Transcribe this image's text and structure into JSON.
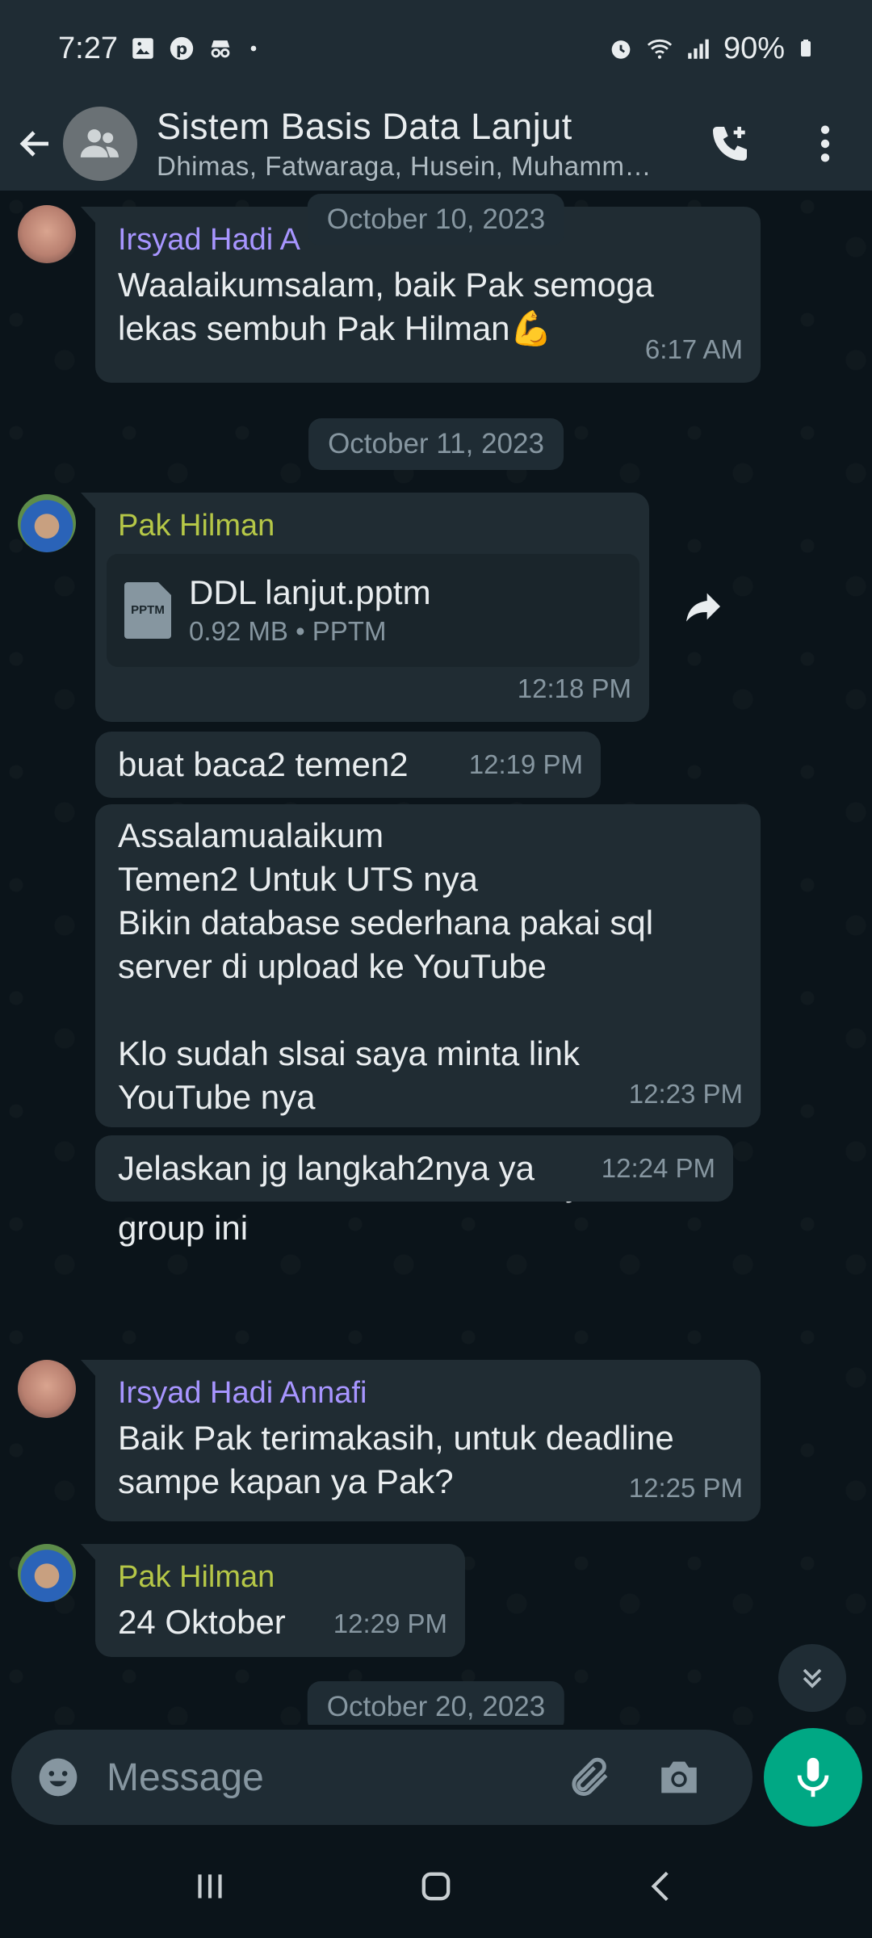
{
  "status_bar": {
    "time": "7:27",
    "battery": "90%",
    "icons": [
      "gallery-icon",
      "pinterest-icon",
      "incognito-icon",
      "dot-icon",
      "alarm-icon",
      "wifi-icon",
      "signal-icon",
      "battery-icon"
    ]
  },
  "header": {
    "title": "Sistem Basis Data Lanjut",
    "subtitle": "Dhimas, Fatwaraga, Husein, Muhamm…"
  },
  "colors": {
    "background": "#0b141a",
    "bar": "#1f2c34",
    "bubble": "#202c33",
    "accent": "#00a884",
    "sender_irsyad": "#a795ff",
    "sender_hilman": "#b5c747",
    "meta_text": "#8696a0"
  },
  "messages": [
    {
      "sender": "Irsyad Hadi A",
      "text": "Waalaikumsalam, baik Pak semoga\nlekas sembuh Pak Hilman💪",
      "time": "6:17 AM"
    },
    {
      "date": "October 10, 2023"
    },
    {
      "date": "October 11, 2023"
    },
    {
      "sender": "Pak Hilman",
      "file_name": "DDL lanjut.pptm",
      "file_info": "0.92 MB • PPTM",
      "file_type": "PPTM",
      "time": "12:18 PM"
    },
    {
      "text": "buat baca2 temen2",
      "time": "12:19 PM"
    },
    {
      "text": "Assalamualaikum\nTemen2 Untuk UTS nya\nBikin database sederhana pakai sql\nserver di upload ke YouTube\n\nKlo sudah slsai saya minta link\nYouTube nya\n\nBoleh di share link YouTube nya di\ngroup ini",
      "time": "12:23 PM"
    },
    {
      "text": "Jelaskan jg langkah2nya ya",
      "time": "12:24 PM"
    },
    {
      "sender": "Irsyad Hadi Annafi",
      "text": "Baik Pak terimakasih, untuk deadline\nsampe kapan ya Pak?",
      "time": "12:25 PM"
    },
    {
      "sender": "Pak Hilman",
      "text": "24 Oktober",
      "time": "12:29 PM"
    },
    {
      "date": "October 20, 2023"
    }
  ],
  "composer": {
    "placeholder": "Message"
  }
}
